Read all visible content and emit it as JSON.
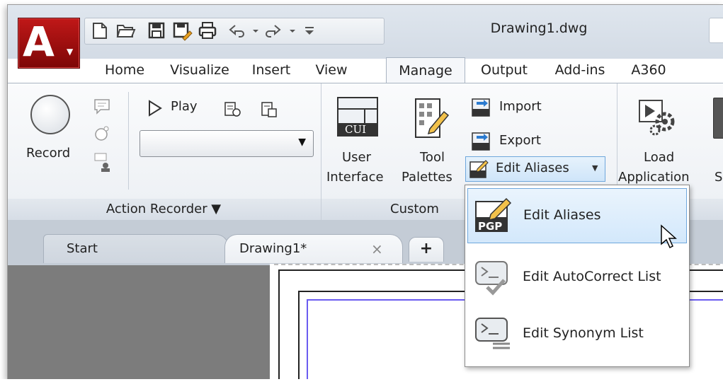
{
  "app": {
    "logo_letter": "A",
    "document_title": "Drawing1.dwg"
  },
  "quick_access": {
    "icons": [
      "new-icon",
      "open-icon",
      "save-icon",
      "save-as-icon",
      "plot-icon",
      "undo-icon",
      "redo-icon",
      "customize-qat-icon"
    ]
  },
  "menu_tabs": [
    {
      "label": "Home"
    },
    {
      "label": "Visualize"
    },
    {
      "label": "Insert"
    },
    {
      "label": "View"
    },
    {
      "label": "Manage",
      "active": true
    },
    {
      "label": "Output"
    },
    {
      "label": "Add-ins"
    },
    {
      "label": "A360"
    }
  ],
  "ribbon": {
    "action_recorder": {
      "record_label": "Record",
      "play_label": "Play",
      "panel_title": "Action Recorder ▼"
    },
    "customization": {
      "user_interface_label_1": "User",
      "user_interface_label_2": "Interface",
      "cui_text": "CUI",
      "tool_palettes_label_1": "Tool",
      "tool_palettes_label_2": "Palettes",
      "import_label": "Import",
      "export_label": "Export",
      "edit_aliases_label": "Edit Aliases",
      "panel_title": "Custom"
    },
    "applications": {
      "load_application_label_1": "Load",
      "load_application_label_2": "Application",
      "partial_label": "S"
    }
  },
  "file_tabs": [
    {
      "label": "Start"
    },
    {
      "label": "Drawing1*",
      "active": true
    }
  ],
  "file_tab_add": "+",
  "file_tab_close": "×",
  "dropdown": {
    "items": [
      {
        "label": "Edit Aliases",
        "icon": "pgp-edit-icon",
        "icon_text": "PGP",
        "highlighted": true
      },
      {
        "label": "Edit AutoCorrect List",
        "icon": "autocorrect-list-icon"
      },
      {
        "label": "Edit Synonym List",
        "icon": "synonym-list-icon"
      }
    ]
  },
  "colors": {
    "accent_red": "#b01010",
    "highlight_blue": "#cfe5f9",
    "highlight_border": "#6fa7dc",
    "viewport_border": "#6a5cf0"
  }
}
